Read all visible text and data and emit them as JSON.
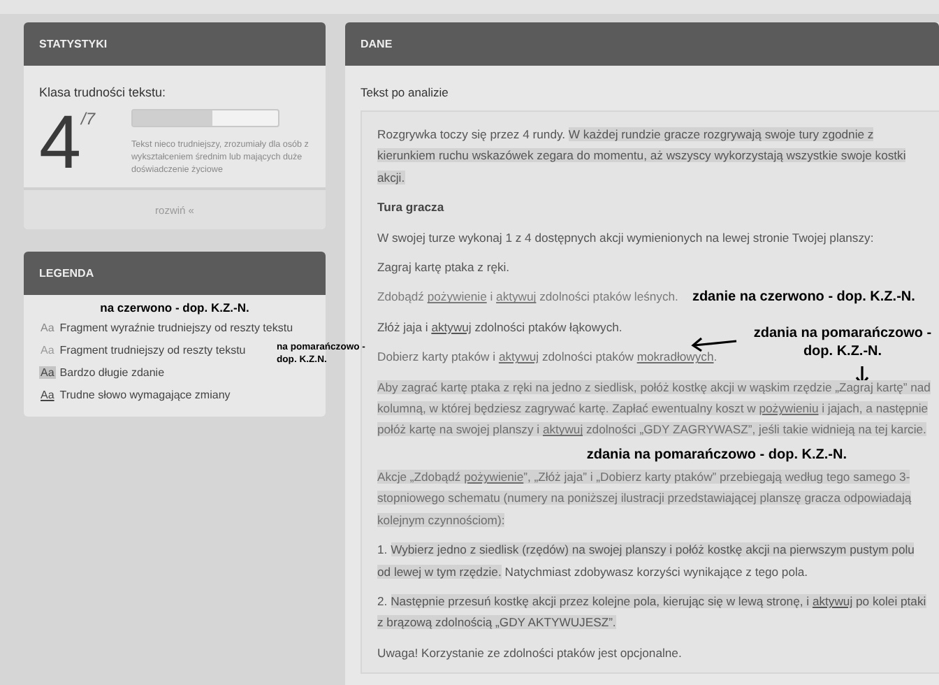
{
  "statistics": {
    "title": "STATYSTYKI",
    "label": "Klasa trudności tekstu:",
    "grade": "4",
    "scale": "/7",
    "level": 0.55,
    "description": "Tekst nieco trudniejszy, zrozumiały dla osób z wykształceniem średnim lub mających duże doświadczenie życiowe",
    "expand": "rozwiń «"
  },
  "legend": {
    "title": "LEGENDA",
    "note_top": "na czerwono - dop. K.Z.-N.",
    "note_side": "na pomarańczowo - dop. K.Z.N.",
    "items": [
      {
        "kind": "hard",
        "sample": "Aa",
        "label": "Fragment wyraźnie trudniejszy od reszty tekstu"
      },
      {
        "kind": "moderate",
        "sample": "Aa",
        "label": "Fragment trudniejszy od reszty tekstu"
      },
      {
        "kind": "long",
        "sample": "Aa",
        "label": "Bardzo długie zdanie"
      },
      {
        "kind": "word",
        "sample": "Aa",
        "label": "Trudne słowo wymagające zmiany"
      }
    ]
  },
  "data": {
    "title": "DANE",
    "subtitle": "Tekst po analizie",
    "paragraphs": [
      {
        "kind": "normal",
        "segments": [
          {
            "kind": "plain",
            "text": "Rozgrywka toczy się przez 4 rundy. "
          },
          {
            "kind": "long",
            "text": "W każdej rundzie gracze rozgrywają swoje tury zgodnie z kierunkiem ruchu wskazówek zegara do momentu, aż wszyscy wykorzystają wszystkie swoje kostki akcji."
          }
        ]
      },
      {
        "kind": "heading",
        "segments": [
          {
            "kind": "plain",
            "text": "Tura gracza"
          }
        ]
      },
      {
        "kind": "normal",
        "segments": [
          {
            "kind": "plain",
            "text": "W swojej turze wykonaj 1 z 4 dostępnych akcji wymienionych na lewej stronie Twojej planszy:"
          }
        ]
      },
      {
        "kind": "normal",
        "segments": [
          {
            "kind": "plain",
            "text": "Zagraj kartę ptaka z ręki."
          }
        ]
      },
      {
        "kind": "hard",
        "note": {
          "kind": "inline",
          "text": "zdanie na czerwono - dop. K.Z.-N."
        },
        "segments": [
          {
            "kind": "plain",
            "text": "Zdobądź "
          },
          {
            "kind": "word",
            "text": "pożywienie"
          },
          {
            "kind": "plain",
            "text": " i "
          },
          {
            "kind": "word",
            "text": "aktywuj"
          },
          {
            "kind": "plain",
            "text": " zdolności ptaków leśnych."
          }
        ]
      },
      {
        "kind": "normal",
        "segments": [
          {
            "kind": "plain",
            "text": "Złóż jaja i "
          },
          {
            "kind": "word",
            "text": "aktywuj"
          },
          {
            "kind": "plain",
            "text": " zdolności ptaków łąkowych."
          }
        ]
      },
      {
        "kind": "moderate",
        "note": {
          "kind": "arrows",
          "text": "zdania na pomarańczowo - dop. K.Z.-N."
        },
        "segments": [
          {
            "kind": "plain",
            "text": "Dobierz karty ptaków i "
          },
          {
            "kind": "word",
            "text": "aktywuj"
          },
          {
            "kind": "plain",
            "text": " zdolności ptaków "
          },
          {
            "kind": "word",
            "text": "mokradłowych"
          },
          {
            "kind": "plain",
            "text": "."
          }
        ]
      },
      {
        "kind": "moderate",
        "note": {
          "kind": "below",
          "text": "zdania na pomarańczowo - dop. K.Z.-N."
        },
        "segments": [
          {
            "kind": "long",
            "text": "Aby zagrać kartę ptaka z ręki na jedno z siedlisk, połóż kostkę akcji w wąskim rzędzie „Zagraj kartę” nad kolumną, w której będziesz zagrywać kartę. "
          },
          {
            "kind": "long",
            "text": "Zapłać ewentualny koszt w "
          },
          {
            "kind": "long_word",
            "text": "pożywieniu"
          },
          {
            "kind": "long",
            "text": " i jajach, a następnie połóż kartę na swojej planszy i "
          },
          {
            "kind": "long_word",
            "text": "aktywuj"
          },
          {
            "kind": "long",
            "text": " zdolności „GDY ZAGRYWASZ”, jeśli takie widnieją na tej karcie."
          }
        ]
      },
      {
        "kind": "moderate",
        "segments": [
          {
            "kind": "long",
            "text": "Akcje „Zdobądź "
          },
          {
            "kind": "long_word",
            "text": "pożywienie"
          },
          {
            "kind": "long",
            "text": "”, „Złóż jaja” i „Dobierz karty ptaków” przebiegają według tego samego 3-stopniowego schematu (numery na poniższej ilustracji przedstawiającej planszę gracza odpowiadają kolejnym czynnościom):"
          }
        ]
      },
      {
        "kind": "normal",
        "segments": [
          {
            "kind": "plain",
            "text": "1. "
          },
          {
            "kind": "long",
            "text": "Wybierz jedno z siedlisk (rzędów) na swojej planszy i połóż kostkę akcji na pierwszym pustym polu od lewej w tym rzędzie."
          },
          {
            "kind": "plain",
            "text": " Natychmiast zdobywasz korzyści wynikające z tego pola."
          }
        ]
      },
      {
        "kind": "normal",
        "segments": [
          {
            "kind": "plain",
            "text": "2. "
          },
          {
            "kind": "long",
            "text": "Następnie przesuń kostkę akcji przez kolejne pola, kierując się w lewą stronę, i "
          },
          {
            "kind": "long_word",
            "text": "aktywuj"
          },
          {
            "kind": "long",
            "text": " po kolei ptaki z brązową zdolnością „GDY AKTYWUJESZ”."
          }
        ]
      },
      {
        "kind": "normal",
        "segments": [
          {
            "kind": "plain",
            "text": "Uwaga! Korzystanie ze zdolności ptaków jest opcjonalne."
          }
        ]
      }
    ]
  }
}
